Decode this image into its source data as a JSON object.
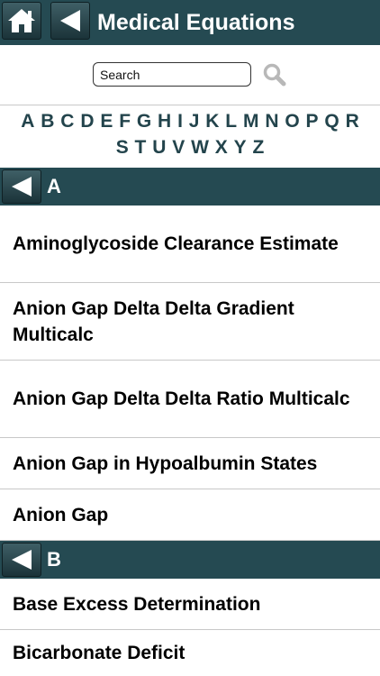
{
  "header": {
    "title": "Medical Equations",
    "home_icon": "home-icon",
    "back_icon": "back-arrow-icon"
  },
  "search": {
    "placeholder": "Search",
    "icon": "magnifier-icon"
  },
  "alphabet": {
    "row1": [
      "A",
      "B",
      "C",
      "D",
      "E",
      "F",
      "G",
      "H",
      "I",
      "J",
      "K",
      "L",
      "M",
      "N",
      "O",
      "P",
      "Q",
      "R"
    ],
    "row2": [
      "S",
      "T",
      "U",
      "V",
      "W",
      "X",
      "Y",
      "Z"
    ]
  },
  "sections": [
    {
      "letter": "A",
      "items": [
        "Aminoglycoside Clearance Estimate",
        "Anion Gap Delta Delta Gradient Multicalc",
        "Anion Gap Delta Delta Ratio Multicalc",
        "Anion Gap in Hypoalbumin States",
        "Anion Gap"
      ]
    },
    {
      "letter": "B",
      "items": [
        "Base Excess Determination",
        "Bicarbonate Deficit"
      ]
    }
  ],
  "colors": {
    "bar": "#254a52",
    "letters": "#23444c"
  }
}
